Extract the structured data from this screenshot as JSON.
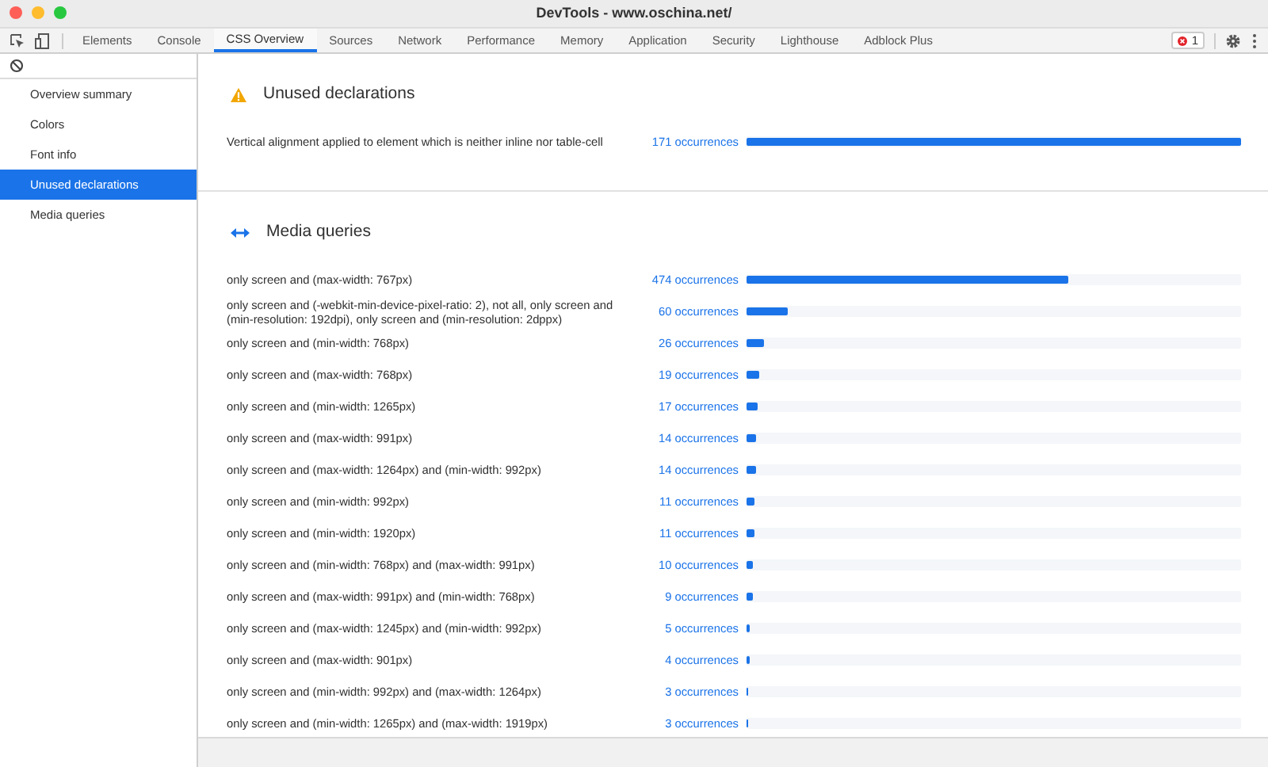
{
  "window": {
    "title": "DevTools - www.oschina.net/"
  },
  "tabs": [
    {
      "label": "Elements",
      "selected": false
    },
    {
      "label": "Console",
      "selected": false
    },
    {
      "label": "CSS Overview",
      "selected": true
    },
    {
      "label": "Sources",
      "selected": false
    },
    {
      "label": "Network",
      "selected": false
    },
    {
      "label": "Performance",
      "selected": false
    },
    {
      "label": "Memory",
      "selected": false
    },
    {
      "label": "Application",
      "selected": false
    },
    {
      "label": "Security",
      "selected": false
    },
    {
      "label": "Lighthouse",
      "selected": false
    },
    {
      "label": "Adblock Plus",
      "selected": false
    }
  ],
  "error_badge": "1",
  "sidebar": {
    "items": [
      {
        "label": "Overview summary",
        "selected": false
      },
      {
        "label": "Colors",
        "selected": false
      },
      {
        "label": "Font info",
        "selected": false
      },
      {
        "label": "Unused declarations",
        "selected": true
      },
      {
        "label": "Media queries",
        "selected": false
      }
    ]
  },
  "sections": [
    {
      "kind": "unused",
      "title": "Unused declarations",
      "rows": [
        {
          "label": "Vertical alignment applied to element which is neither inline nor table-cell",
          "count": "171 occurrences",
          "level": 1
        }
      ]
    },
    {
      "kind": "media",
      "title": "Media queries",
      "rows": [
        {
          "label": "only screen and (max-width: 767px)",
          "count": "474 occurrences",
          "level": 0.65
        },
        {
          "label": "only screen and (-webkit-min-device-pixel-ratio: 2), not all, only screen and (min-resolution: 192dpi), only screen and (min-resolution: 2dppx)",
          "count": "60 occurrences",
          "level": 0.083
        },
        {
          "label": "only screen and (min-width: 768px)",
          "count": "26 occurrences",
          "level": 0.036
        },
        {
          "label": "only screen and (max-width: 768px)",
          "count": "19 occurrences",
          "level": 0.026
        },
        {
          "label": "only screen and (min-width: 1265px)",
          "count": "17 occurrences",
          "level": 0.023
        },
        {
          "label": "only screen and (max-width: 991px)",
          "count": "14 occurrences",
          "level": 0.019
        },
        {
          "label": "only screen and (max-width: 1264px) and (min-width: 992px)",
          "count": "14 occurrences",
          "level": 0.019
        },
        {
          "label": "only screen and (min-width: 992px)",
          "count": "11 occurrences",
          "level": 0.015
        },
        {
          "label": "only screen and (min-width: 1920px)",
          "count": "11 occurrences",
          "level": 0.015
        },
        {
          "label": "only screen and (min-width: 768px) and (max-width: 991px)",
          "count": "10 occurrences",
          "level": 0.014
        },
        {
          "label": "only screen and (max-width: 991px) and (min-width: 768px)",
          "count": "9 occurrences",
          "level": 0.012
        },
        {
          "label": "only screen and (max-width: 1245px) and (min-width: 992px)",
          "count": "5 occurrences",
          "level": 0.007
        },
        {
          "label": "only screen and (max-width: 901px)",
          "count": "4 occurrences",
          "level": 0.006
        },
        {
          "label": "only screen and (min-width: 992px) and (max-width: 1264px)",
          "count": "3 occurrences",
          "level": 0.004
        },
        {
          "label": "only screen and (min-width: 1265px) and (max-width: 1919px)",
          "count": "3 occurrences",
          "level": 0.004
        }
      ]
    }
  ]
}
